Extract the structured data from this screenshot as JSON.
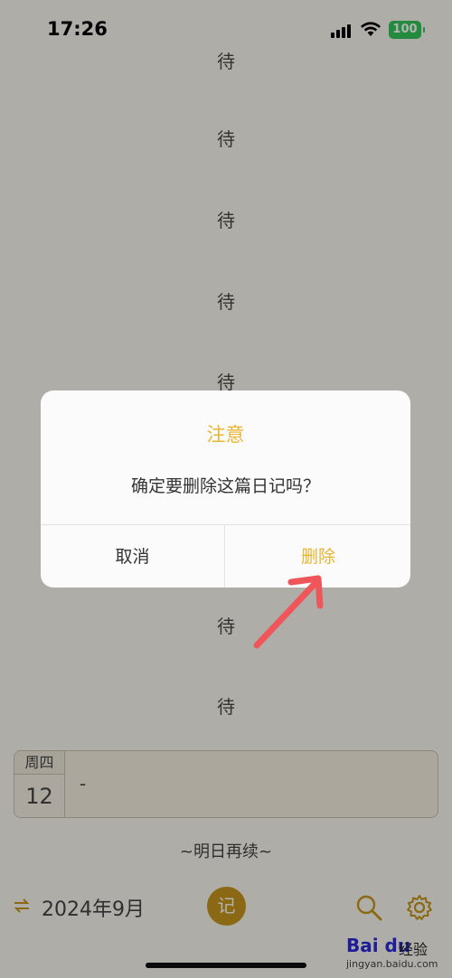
{
  "status_bar": {
    "time": "17:26",
    "battery": "100"
  },
  "background_list": {
    "items": [
      "待",
      "待",
      "待",
      "待",
      "待",
      "待",
      "待"
    ]
  },
  "entry": {
    "weekday": "周四",
    "day": "12",
    "text": "-"
  },
  "continue_note": "~明日再续~",
  "bottom_bar": {
    "month": "2024年9月",
    "write_label": "记"
  },
  "dialog": {
    "title": "注意",
    "message": "确定要删除这篇日记吗？",
    "cancel_label": "取消",
    "delete_label": "删除"
  },
  "watermark": {
    "brand": "Bai du",
    "jingyan": "经验",
    "url": "jingyan.baidu.com"
  },
  "colors": {
    "accent": "#e9b430",
    "accent_dark": "#c8951e",
    "annotation_arrow": "#f0555a"
  }
}
